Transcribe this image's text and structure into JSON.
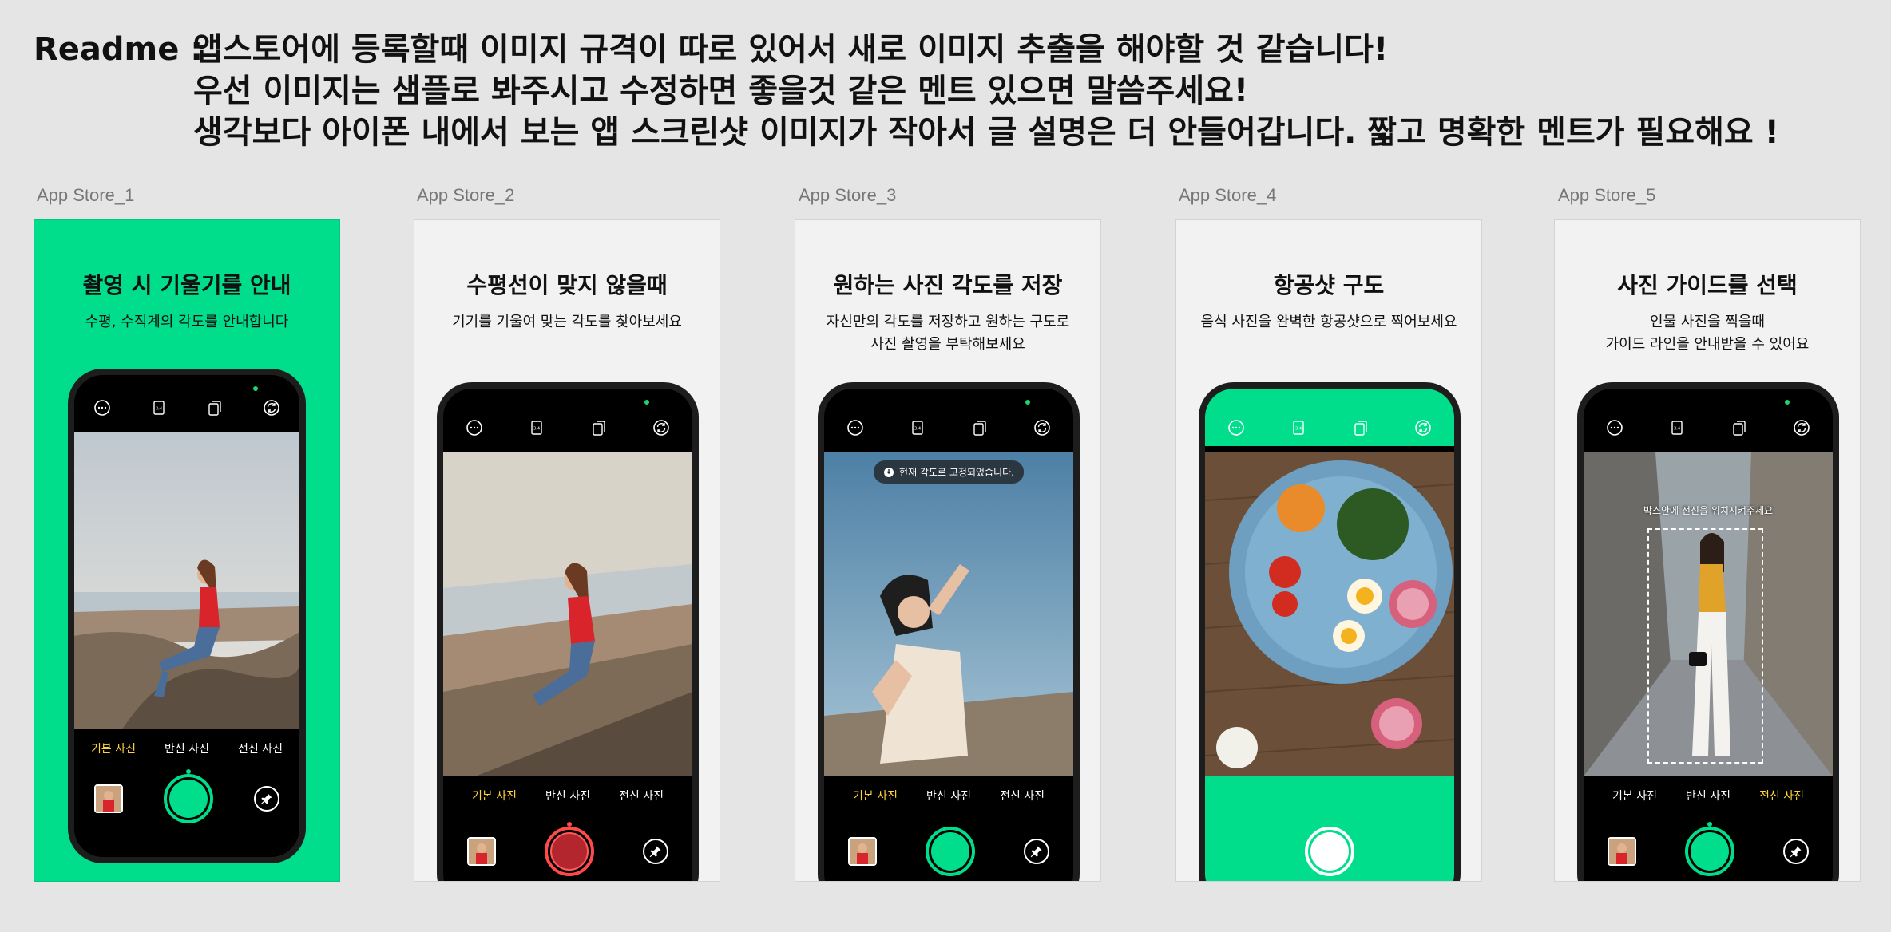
{
  "readme": {
    "label": "Readme :",
    "lines": [
      "앱스토어에 등록할때 이미지 규격이 따로 있어서 새로 이미지 추출을 해야할 것 같습니다!",
      "우선 이미지는 샘플로 봐주시고 수정하면 좋을것 같은 멘트 있으면 말씀주세요!",
      "생각보다 아이폰 내에서 보는 앱 스크린샷 이미지가 작아서 글 설명은 더 안들어갑니다. 짧고 명확한 멘트가 필요해요 !"
    ]
  },
  "modes": [
    "기본 사진",
    "반신 사진",
    "전신 사진"
  ],
  "frames": [
    {
      "label": "App Store_1",
      "title": "촬영 시 기울기를 안내",
      "subtitle": "수평, 수직계의 각도를 안내합니다"
    },
    {
      "label": "App Store_2",
      "title": "수평선이 맞지 않을때",
      "subtitle": "기기를 기울여 맞는 각도를 찾아보세요"
    },
    {
      "label": "App Store_3",
      "title": "원하는 사진 각도를 저장",
      "subtitle": "자신만의 각도를 저장하고 원하는 구도로\n사진 촬영을 부탁해보세요",
      "toast": "현재 각도로 고정되었습니다."
    },
    {
      "label": "App Store_4",
      "title": "항공샷 구도",
      "subtitle": "음식 사진을 완벽한 항공샷으로 찍어보세요"
    },
    {
      "label": "App Store_5",
      "title": "사진 가이드를 선택",
      "subtitle": "인물 사진을 찍을때\n가이드 라인을 안내받을 수 있어요",
      "guide": "박스안에 전신을 위치시켜주세요"
    }
  ],
  "colors": {
    "brand_green": "#00de8c",
    "active_mode": "#ffd43b",
    "background": "#e5e5e5"
  },
  "icons": [
    "more-icon",
    "ratio-icon",
    "copy-icon",
    "switch-camera-icon",
    "pin-icon"
  ]
}
